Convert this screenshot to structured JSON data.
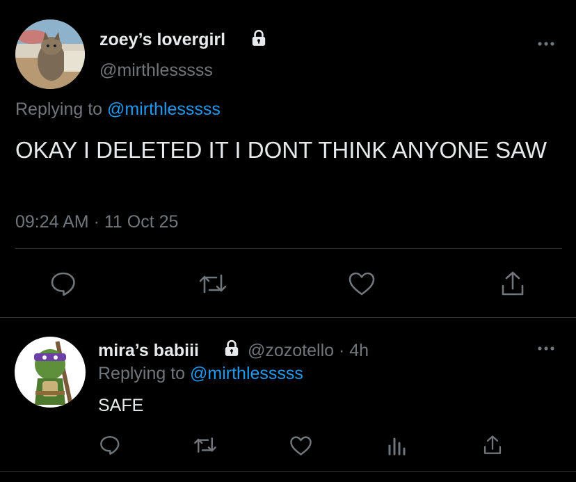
{
  "tweet": {
    "author_name": "zoey’s lovergirl",
    "author_handle": "@mirthlesssss",
    "replying_prefix": "Replying to ",
    "replying_handle": "@mirthlesssss",
    "text": "OKAY I DELETED IT I DONT THINK ANYONE SAW",
    "timestamp": "09:24 AM · 11 Oct 25"
  },
  "reply": {
    "author_name": "mira’s babiii",
    "author_handle": "@zozotello",
    "time_sep": " · ",
    "time": "4h",
    "replying_prefix": "Replying to ",
    "replying_handle": "@mirthlesssss",
    "text": "SAFE"
  },
  "colors": {
    "background": "#000000",
    "text": "#e7e9ea",
    "muted": "#71767b",
    "link": "#1d9bf0",
    "divider": "#2f3336"
  },
  "icons": [
    "lock-icon",
    "more-icon",
    "reply-icon",
    "retweet-icon",
    "like-icon",
    "share-icon",
    "analytics-icon"
  ]
}
